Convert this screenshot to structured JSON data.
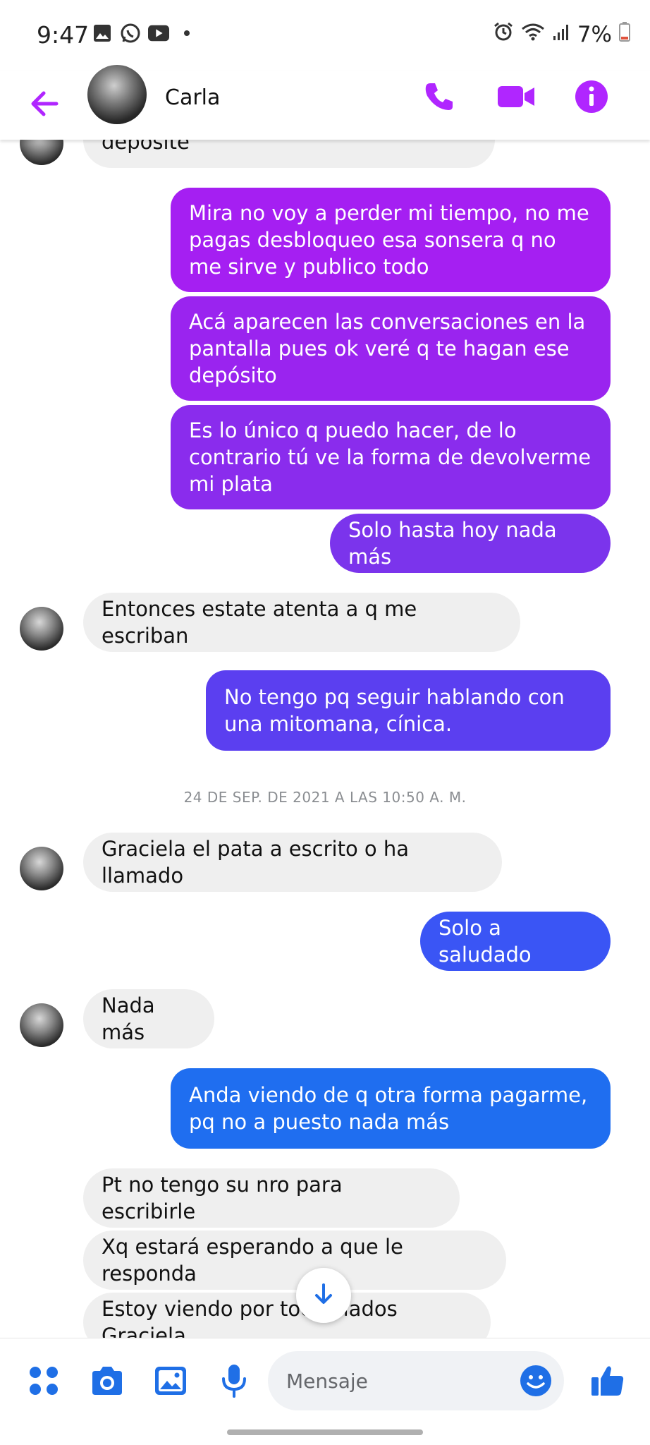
{
  "status_bar": {
    "time": "9:47",
    "battery": "7%"
  },
  "header": {
    "contact_name": "Carla"
  },
  "messages": {
    "m0": "deposite",
    "m1": "Mira no voy a perder mi tiempo, no me pagas desbloqueo esa sonsera q no me sirve y publico todo",
    "m2": "Acá aparecen las conversaciones en la pantalla pues ok veré q te hagan ese depósito",
    "m3": "Es lo único q puedo hacer, de lo contrario tú ve la forma de devolverme mi plata",
    "m4": "Solo hasta hoy nada más",
    "m5": "Entonces estate atenta a q me escriban",
    "m6": "No tengo pq seguir hablando con una mitomana, cínica.",
    "timestamp": "24 DE SEP. DE 2021 A LAS 10:50 A. M.",
    "m7": "Graciela el pata a escrito o ha llamado",
    "m8": "Solo a saludado",
    "m9": "Nada más",
    "m10": "Anda viendo de q otra forma pagarme, pq no a puesto nada más",
    "m11": "Pt no tengo su nro para escribirle",
    "m12": "Xq estará esperando a que le responda",
    "m13": "Estoy viendo por todos lados Graciela"
  },
  "composer": {
    "placeholder": "Mensaje"
  },
  "colors": {
    "accent": "#b026ff",
    "out_1": "#a51ff2",
    "out_2": "#9a24ef",
    "out_3": "#8a2ced",
    "out_4": "#7b34ec",
    "out_5": "#5b3ff0",
    "out_6": "#3a55f5",
    "out_7": "#1f6ef0",
    "composer_icons": "#1f6fe6",
    "incoming_bg": "#efefef"
  },
  "icons": {
    "back": "arrow-left-icon",
    "call": "phone-icon",
    "video": "video-camera-icon",
    "info": "info-icon",
    "menu": "four-dots-icon",
    "camera": "camera-icon",
    "gallery": "image-icon",
    "mic": "microphone-icon",
    "emoji": "smiley-icon",
    "like": "thumbs-up-icon",
    "scroll": "arrow-down-icon"
  }
}
